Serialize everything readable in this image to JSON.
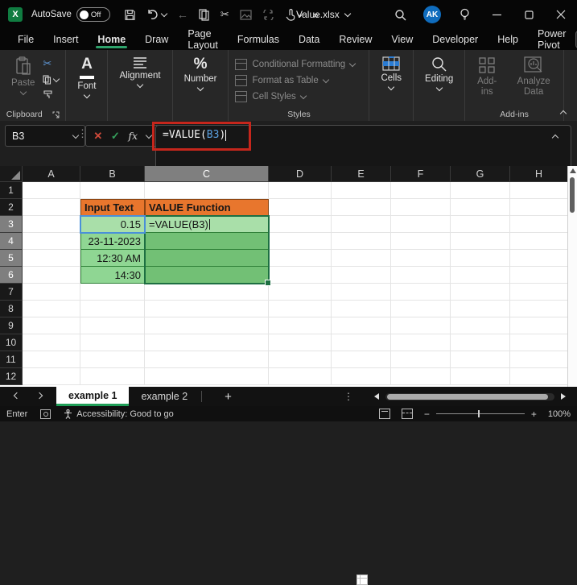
{
  "colors": {
    "excel_green": "#107C41",
    "active_underline": "#2EA26B",
    "header_orange": "#E8762D",
    "light_green": "#A9DFA9",
    "mid_green": "#8FD693",
    "dark_green": "#72C075",
    "selection_border": "#1D6F42",
    "reference_blue": "#4A90D9",
    "annotation_red": "#C5261C",
    "avatar_blue": "#0F6CBD"
  },
  "titlebar": {
    "autosave_label": "AutoSave",
    "autosave_state": "Off",
    "doc_title": "Value.xlsx",
    "avatar_initials": "AK",
    "overflow_glyph": "»",
    "icons": [
      "excel-logo",
      "save",
      "undo",
      "back",
      "copy",
      "cut",
      "picture",
      "replace",
      "touch-mode",
      "search",
      "lightbulb",
      "minimize",
      "maximize",
      "close"
    ]
  },
  "menubar": {
    "items": [
      "File",
      "Insert",
      "Home",
      "Draw",
      "Page Layout",
      "Formulas",
      "Data",
      "Review",
      "View",
      "Developer",
      "Help",
      "Power Pivot"
    ],
    "active": "Home"
  },
  "ribbon": {
    "paste_label": "Paste",
    "clipboard_group": "Clipboard",
    "font_label": "Font",
    "alignment_label": "Alignment",
    "number_label": "Number",
    "conditional_formatting": "Conditional Formatting",
    "format_as_table": "Format as Table",
    "cell_styles": "Cell Styles",
    "styles_group": "Styles",
    "cells_label": "Cells",
    "editing_label": "Editing",
    "addins_label": "Add-ins",
    "analyze_data_label": "Analyze Data",
    "addins_group": "Add-ins"
  },
  "formulabar": {
    "name_box": "B3",
    "cancel_glyph": "✕",
    "enter_glyph": "✓",
    "fx_label": "fx",
    "formula_prefix": "=VALUE(",
    "formula_ref": "B3",
    "formula_suffix": ")"
  },
  "grid": {
    "columns": [
      "A",
      "B",
      "C",
      "D",
      "E",
      "F",
      "G",
      "H"
    ],
    "active_column": "C",
    "row_count": 12,
    "active_rows": [
      3,
      4,
      5,
      6
    ],
    "cells": {
      "B2": "Input Text",
      "C2": "VALUE Function",
      "B3": "0.15",
      "C3": "=VALUE(B3)",
      "B4": "23-11-2023",
      "B5": "12:30 AM",
      "B6": "14:30"
    }
  },
  "tabs": {
    "items": [
      "example 1",
      "example 2"
    ],
    "active": "example 1",
    "add_label": "+",
    "menu_glyph": "⋮"
  },
  "statusbar": {
    "mode": "Enter",
    "accessibility": "Accessibility: Good to go",
    "zoom_out": "−",
    "zoom_in": "+",
    "zoom_level": "100%"
  }
}
